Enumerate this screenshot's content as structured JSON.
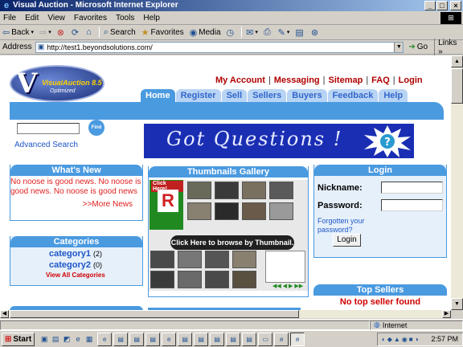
{
  "window": {
    "title": "Visual Auction - Microsoft Internet Explorer",
    "buttons": [
      "_",
      "□",
      "×"
    ]
  },
  "menu": [
    "File",
    "Edit",
    "View",
    "Favorites",
    "Tools",
    "Help"
  ],
  "toolbar": {
    "back": "Back",
    "search": "Search",
    "favorites": "Favorites",
    "media": "Media"
  },
  "address": {
    "label": "Address",
    "url": "http://test1.beyondsolutions.com/",
    "go": "Go",
    "links": "Links"
  },
  "site": {
    "logo_letter": "V",
    "logo_name": "VisualAuction 8.5",
    "logo_sub": "Optimized",
    "top_links": [
      "My Account",
      "Messaging",
      "Sitemap",
      "FAQ",
      "Login"
    ],
    "tabs": [
      {
        "label": "Home",
        "active": true
      },
      {
        "label": "Register"
      },
      {
        "label": "Sell"
      },
      {
        "label": "Sellers"
      },
      {
        "label": "Buyers"
      },
      {
        "label": "Feedback"
      },
      {
        "label": "Help"
      }
    ],
    "search": {
      "find": "Find",
      "advanced": "Advanced Search",
      "value": ""
    },
    "banner": "Got Questions !",
    "whats_new": {
      "title": "What's New",
      "text": "No noose is good news. No noose is good news. No noose is good news",
      "more": ">>More News"
    },
    "categories": {
      "title": "Categories",
      "items": [
        {
          "name": "category1",
          "count": "(2)"
        },
        {
          "name": "category2",
          "count": "(0)"
        }
      ],
      "view_all": "View All Categories"
    },
    "gallery": {
      "title": "Thumbnails Gallery",
      "click_here": "Click Here!",
      "callout": "Click Here to browse by Thumbnail."
    },
    "login": {
      "title": "Login",
      "nickname": "Nickname:",
      "password": "Password:",
      "forgot": "Forgotten your password?",
      "button": "Login"
    },
    "top_sellers": {
      "title": "Top Sellers",
      "empty": "No top seller found"
    }
  },
  "status": {
    "zone": "Internet"
  },
  "taskbar": {
    "start": "Start",
    "clock": "2:57 PM"
  },
  "colors": {
    "accent": "#4a9ae0",
    "link_red": "#b00000",
    "link_blue": "#1e56c8"
  }
}
